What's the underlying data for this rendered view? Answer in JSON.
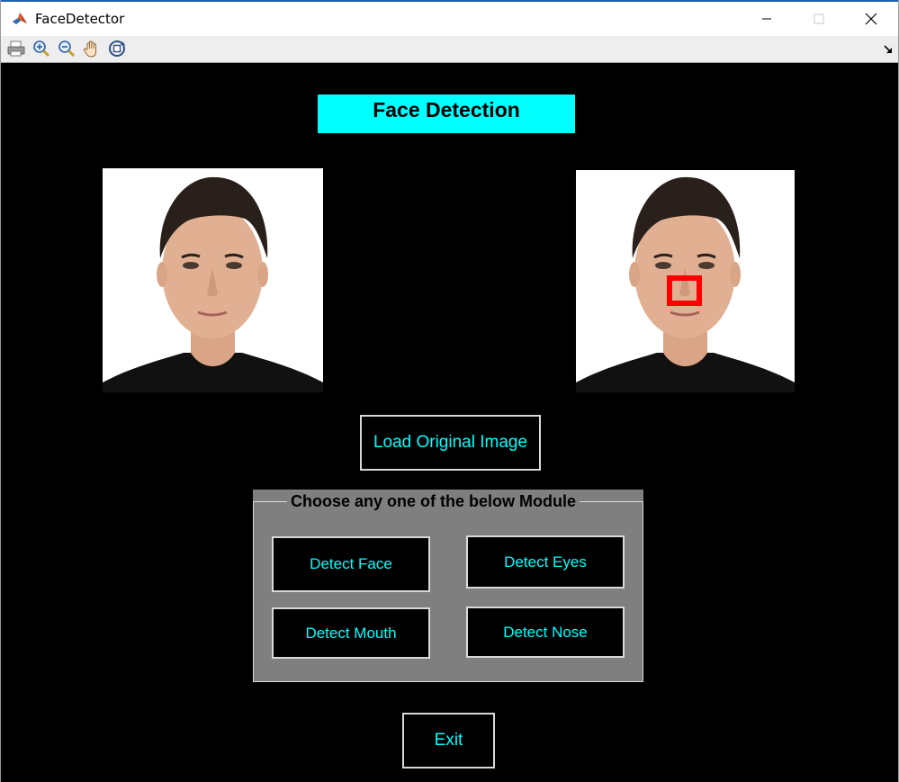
{
  "window": {
    "title": "FaceDetector"
  },
  "titlebar_icons": [
    "matlab-logo-icon",
    "minimize-icon",
    "maximize-icon",
    "close-icon"
  ],
  "toolbar": {
    "icons": [
      "print-icon",
      "zoom-in-icon",
      "zoom-out-icon",
      "pan-hand-icon",
      "rotate-3d-icon",
      "dock-arrow-icon"
    ]
  },
  "header": {
    "title": "Face Detection"
  },
  "images": {
    "original": "portrait of a man (original)",
    "detected": "portrait of a man with nose detection box"
  },
  "buttons": {
    "load_original": "Load Original Image",
    "exit": "Exit"
  },
  "module_panel": {
    "title": "Choose any one of the below Module",
    "detect_face": "Detect Face",
    "detect_eyes": "Detect Eyes",
    "detect_mouth": "Detect Mouth",
    "detect_nose": "Detect Nose"
  },
  "colors": {
    "background": "#000000",
    "accent": "#00ffff",
    "panel": "#7f7f7f",
    "detection_box": "#ff0000"
  }
}
